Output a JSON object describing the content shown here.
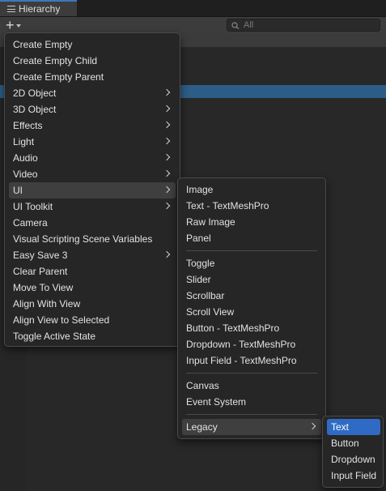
{
  "panel": {
    "tab_title": "Hierarchy"
  },
  "toolbar": {
    "search_placeholder": "All"
  },
  "create_menu": {
    "items": [
      {
        "label": "Create Empty"
      },
      {
        "label": "Create Empty Child"
      },
      {
        "label": "Create Empty Parent"
      },
      {
        "label": "2D Object",
        "submenu": true
      },
      {
        "label": "3D Object",
        "submenu": true
      },
      {
        "label": "Effects",
        "submenu": true
      },
      {
        "label": "Light",
        "submenu": true
      },
      {
        "label": "Audio",
        "submenu": true
      },
      {
        "label": "Video",
        "submenu": true
      },
      {
        "label": "UI",
        "submenu": true,
        "highlighted": true
      },
      {
        "label": "UI Toolkit",
        "submenu": true
      },
      {
        "label": "Camera"
      },
      {
        "label": "Visual Scripting Scene Variables"
      },
      {
        "label": "Easy Save 3",
        "submenu": true
      },
      {
        "label": "Clear Parent"
      },
      {
        "label": "Move To View"
      },
      {
        "label": "Align With View"
      },
      {
        "label": "Align View to Selected"
      },
      {
        "label": "Toggle Active State"
      }
    ]
  },
  "ui_submenu": {
    "groups": [
      [
        "Image",
        "Text - TextMeshPro",
        "Raw Image",
        "Panel"
      ],
      [
        "Toggle",
        "Slider",
        "Scrollbar",
        "Scroll View",
        "Button - TextMeshPro",
        "Dropdown - TextMeshPro",
        "Input Field - TextMeshPro"
      ],
      [
        "Canvas",
        "Event System"
      ],
      [
        "Legacy"
      ]
    ],
    "highlighted": "Legacy"
  },
  "legacy_submenu": {
    "items": [
      "Text",
      "Button",
      "Dropdown",
      "Input Field"
    ],
    "selected": "Text"
  },
  "colors": {
    "selection": "#2f6bc4",
    "accent": "#3a79bb",
    "menu_bg": "#262626"
  },
  "icons": {
    "tab": "hierarchy-list-icon",
    "add": "plus-icon",
    "search": "search-icon",
    "submenu": "chevron-right-icon"
  }
}
